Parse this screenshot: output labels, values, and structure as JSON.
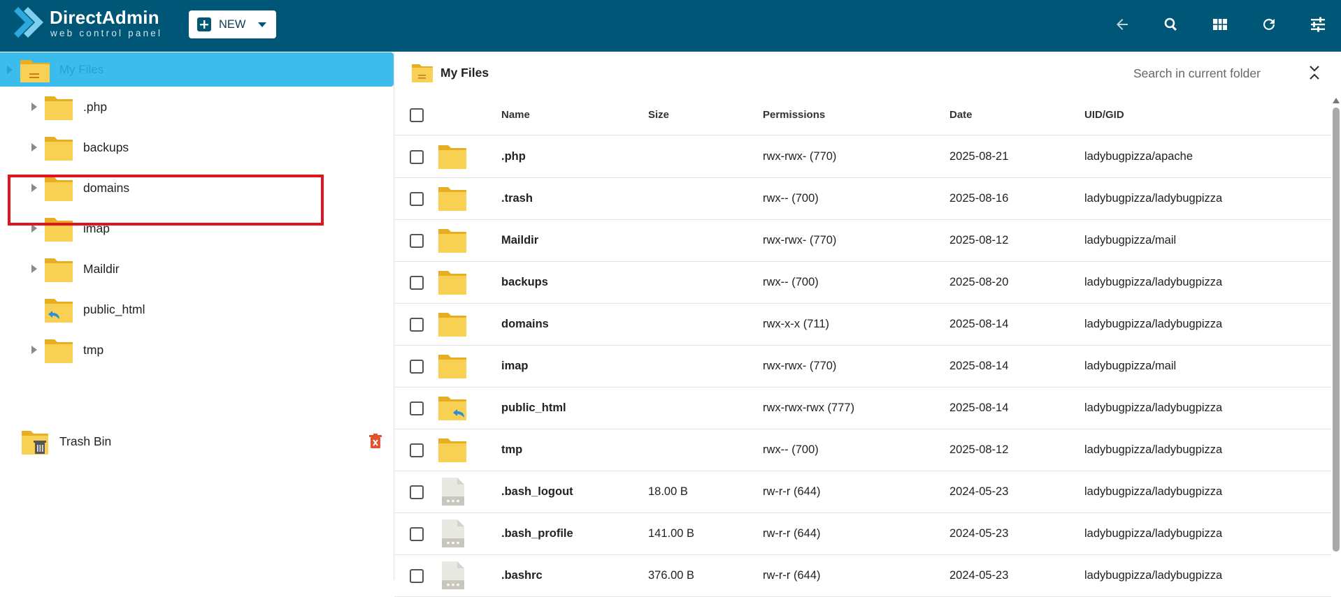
{
  "header": {
    "logo_title": "DirectAdmin",
    "logo_subtitle": "web control panel",
    "new_label": "NEW",
    "tools": [
      "back-arrow-icon",
      "search-icon",
      "grid-view-icon",
      "refresh-icon",
      "settings-sliders-icon"
    ],
    "brand_color": "#005677"
  },
  "tree": {
    "root_label": "My Files",
    "items": [
      {
        "label": ".php",
        "expandable": true,
        "icon": "folder-icon"
      },
      {
        "label": "backups",
        "expandable": true,
        "icon": "folder-icon"
      },
      {
        "label": "domains",
        "expandable": true,
        "icon": "folder-icon"
      },
      {
        "label": "imap",
        "expandable": true,
        "icon": "folder-icon"
      },
      {
        "label": "Maildir",
        "expandable": true,
        "icon": "folder-icon"
      },
      {
        "label": "public_html",
        "expandable": false,
        "icon": "folder-link-icon"
      },
      {
        "label": "tmp",
        "expandable": true,
        "icon": "folder-icon"
      }
    ],
    "trash_label": "Trash Bin",
    "highlight_color": "#e0141e",
    "selected_color": "#3bbcec"
  },
  "pane": {
    "title": "My Files",
    "search_placeholder": "Search in current folder",
    "columns": {
      "name": "Name",
      "size": "Size",
      "permissions": "Permissions",
      "date": "Date",
      "uid": "UID/GID"
    },
    "rows": [
      {
        "name": ".php",
        "size": "",
        "permissions": "rwx-rwx- (770)",
        "date": "2025-08-21",
        "uid": "ladybugpizza/apache",
        "type": "folder"
      },
      {
        "name": ".trash",
        "size": "",
        "permissions": "rwx-- (700)",
        "date": "2025-08-16",
        "uid": "ladybugpizza/ladybugpizza",
        "type": "folder"
      },
      {
        "name": "Maildir",
        "size": "",
        "permissions": "rwx-rwx- (770)",
        "date": "2025-08-12",
        "uid": "ladybugpizza/mail",
        "type": "folder"
      },
      {
        "name": "backups",
        "size": "",
        "permissions": "rwx-- (700)",
        "date": "2025-08-20",
        "uid": "ladybugpizza/ladybugpizza",
        "type": "folder"
      },
      {
        "name": "domains",
        "size": "",
        "permissions": "rwx-x-x (711)",
        "date": "2025-08-14",
        "uid": "ladybugpizza/ladybugpizza",
        "type": "folder"
      },
      {
        "name": "imap",
        "size": "",
        "permissions": "rwx-rwx- (770)",
        "date": "2025-08-14",
        "uid": "ladybugpizza/mail",
        "type": "folder"
      },
      {
        "name": "public_html",
        "size": "",
        "permissions": "rwx-rwx-rwx (777)",
        "date": "2025-08-14",
        "uid": "ladybugpizza/ladybugpizza",
        "type": "folder-link"
      },
      {
        "name": "tmp",
        "size": "",
        "permissions": "rwx-- (700)",
        "date": "2025-08-12",
        "uid": "ladybugpizza/ladybugpizza",
        "type": "folder"
      },
      {
        "name": ".bash_logout",
        "size": "18.00 B",
        "permissions": "rw-r-r (644)",
        "date": "2024-05-23",
        "uid": "ladybugpizza/ladybugpizza",
        "type": "file"
      },
      {
        "name": ".bash_profile",
        "size": "141.00 B",
        "permissions": "rw-r-r (644)",
        "date": "2024-05-23",
        "uid": "ladybugpizza/ladybugpizza",
        "type": "file"
      },
      {
        "name": ".bashrc",
        "size": "376.00 B",
        "permissions": "rw-r-r (644)",
        "date": "2024-05-23",
        "uid": "ladybugpizza/ladybugpizza",
        "type": "file"
      }
    ]
  }
}
